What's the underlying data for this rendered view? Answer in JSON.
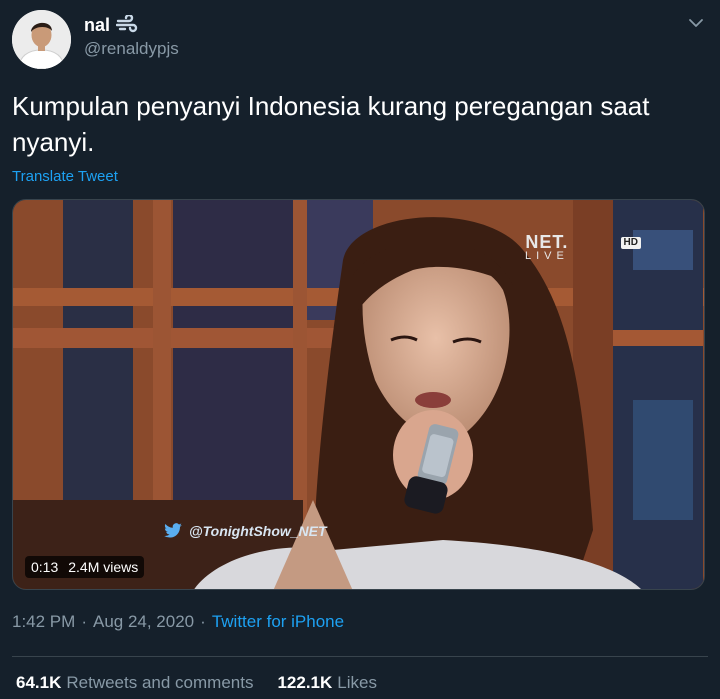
{
  "author": {
    "display_name": "nal",
    "handle": "@renaldypjs",
    "name_emoji": "dash-icon"
  },
  "tweet": {
    "text": "Kumpulan penyanyi Indonesia kurang peregangan saat nyanyi.",
    "translate_label": "Translate Tweet"
  },
  "media": {
    "duration": "0:13",
    "views": "2.4M views",
    "channel_logo": "NET.",
    "channel_logo_sub": "LIVE",
    "hd_badge": "HD",
    "watermark": "@TonightShow_NET"
  },
  "meta": {
    "time": "1:42 PM",
    "separator1": "·",
    "date": "Aug 24, 2020",
    "separator2": "·",
    "source": "Twitter for iPhone"
  },
  "stats": {
    "retweets_count": "64.1K",
    "retweets_label": "Retweets and comments",
    "likes_count": "122.1K",
    "likes_label": "Likes"
  },
  "colors": {
    "background": "#15202b",
    "accent": "#1da1f2",
    "secondary_text": "#8899a6"
  }
}
